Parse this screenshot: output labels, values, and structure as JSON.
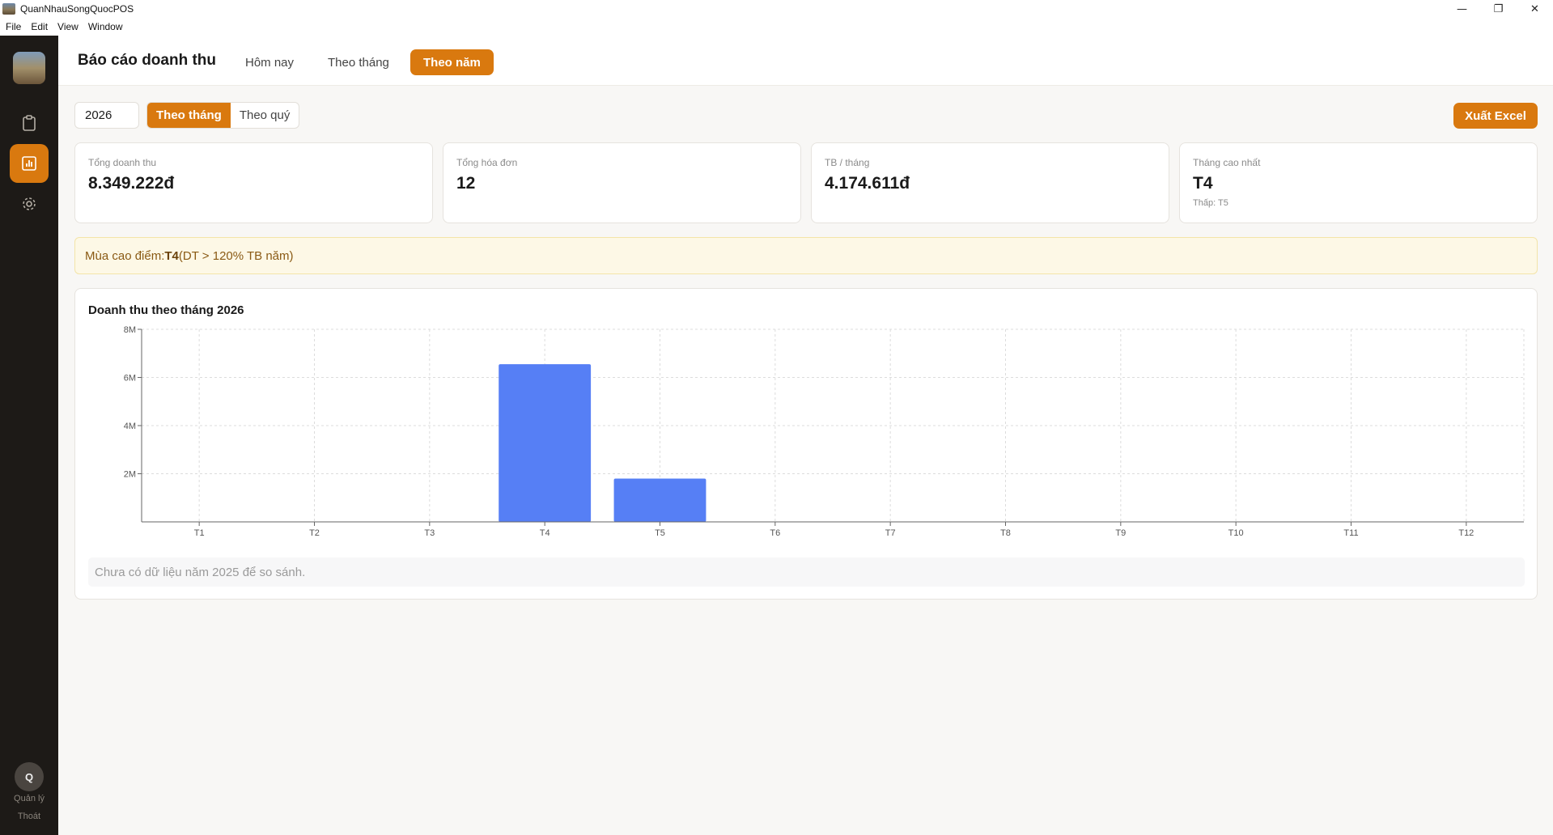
{
  "window": {
    "title": "QuanNhauSongQuocPOS",
    "minimize": "—",
    "restore": "❐",
    "close": "✕"
  },
  "menu": [
    "File",
    "Edit",
    "View",
    "Window"
  ],
  "sidebar": {
    "user_initial": "Q",
    "user_role": "Quản lý",
    "logout": "Thoát"
  },
  "header": {
    "title": "Báo cáo doanh thu",
    "tabs": [
      {
        "label": "Hôm nay"
      },
      {
        "label": "Theo tháng"
      },
      {
        "label": "Theo năm",
        "active": true
      }
    ]
  },
  "controls": {
    "year": "2026",
    "segments": [
      {
        "label": "Theo tháng",
        "active": true
      },
      {
        "label": "Theo quý"
      }
    ],
    "export_label": "Xuất Excel"
  },
  "stats": [
    {
      "label": "Tổng doanh thu",
      "value": "8.349.222đ"
    },
    {
      "label": "Tổng hóa đơn",
      "value": "12"
    },
    {
      "label": "TB / tháng",
      "value": "4.174.611đ"
    },
    {
      "label": "Tháng cao nhất",
      "value": "T4",
      "sub": "Thấp: T5"
    }
  ],
  "banner": {
    "prefix": "Mùa cao điểm: ",
    "month": "T4",
    "suffix": " (DT > 120% TB năm)"
  },
  "chart": {
    "title": "Doanh thu theo tháng 2026",
    "note": "Chưa có dữ liệu năm 2025 để so sánh."
  },
  "chart_data": {
    "type": "bar",
    "title": "Doanh thu theo tháng 2026",
    "categories": [
      "T1",
      "T2",
      "T3",
      "T4",
      "T5",
      "T6",
      "T7",
      "T8",
      "T9",
      "T10",
      "T11",
      "T12"
    ],
    "values": [
      0,
      0,
      0,
      6550000,
      1800000,
      0,
      0,
      0,
      0,
      0,
      0,
      0
    ],
    "ylim": [
      0,
      8000000
    ],
    "yticks": [
      {
        "value": 2000000,
        "label": "2M"
      },
      {
        "value": 4000000,
        "label": "4M"
      },
      {
        "value": 6000000,
        "label": "6M"
      },
      {
        "value": 8000000,
        "label": "8M"
      }
    ],
    "grid": true,
    "bar_color": "#567ff5"
  },
  "colors": {
    "accent": "#d9790f",
    "sidebar_bg": "#1d1a17",
    "bar": "#567ff5"
  },
  "icons": {
    "sidebar": [
      "clipboard-icon",
      "bar-chart-icon",
      "gear-icon"
    ]
  }
}
